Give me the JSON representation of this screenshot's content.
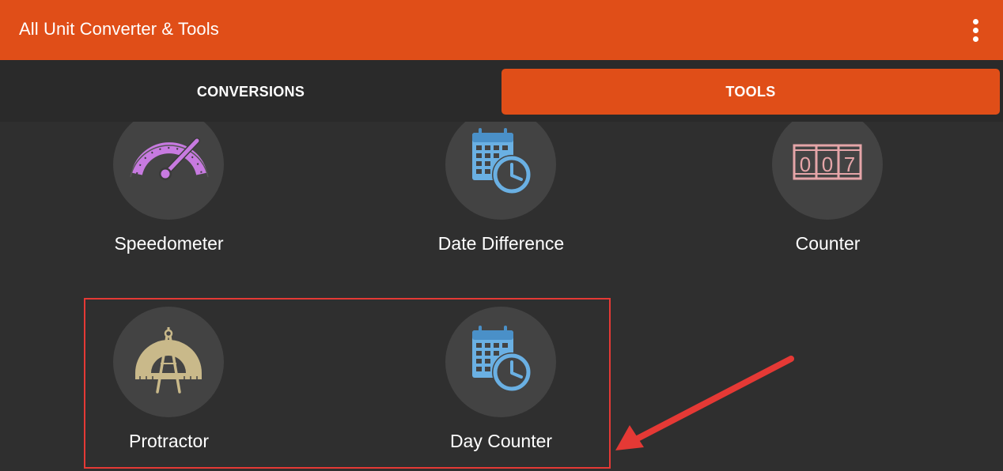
{
  "app": {
    "title": "All Unit Converter & Tools",
    "overflow_icon": "more-vert-icon"
  },
  "tabs": [
    {
      "label": "CONVERSIONS",
      "selected": false
    },
    {
      "label": "TOOLS",
      "selected": true
    }
  ],
  "colors": {
    "primary": "#e04e18",
    "background": "#2f2f2f",
    "tab_bar": "#2a2a2a",
    "icon_circle": "#434343",
    "annotation": "#e53935"
  },
  "tools": [
    {
      "label": "Speedometer",
      "icon": "speedometer-icon"
    },
    {
      "label": "Date Difference",
      "icon": "calendar-clock-icon"
    },
    {
      "label": "Counter",
      "icon": "counter-icon"
    },
    {
      "label": "Protractor",
      "icon": "protractor-compass-icon"
    },
    {
      "label": "Day Counter",
      "icon": "calendar-clock-icon"
    }
  ],
  "counter_digits": [
    "0",
    "0",
    "7"
  ]
}
